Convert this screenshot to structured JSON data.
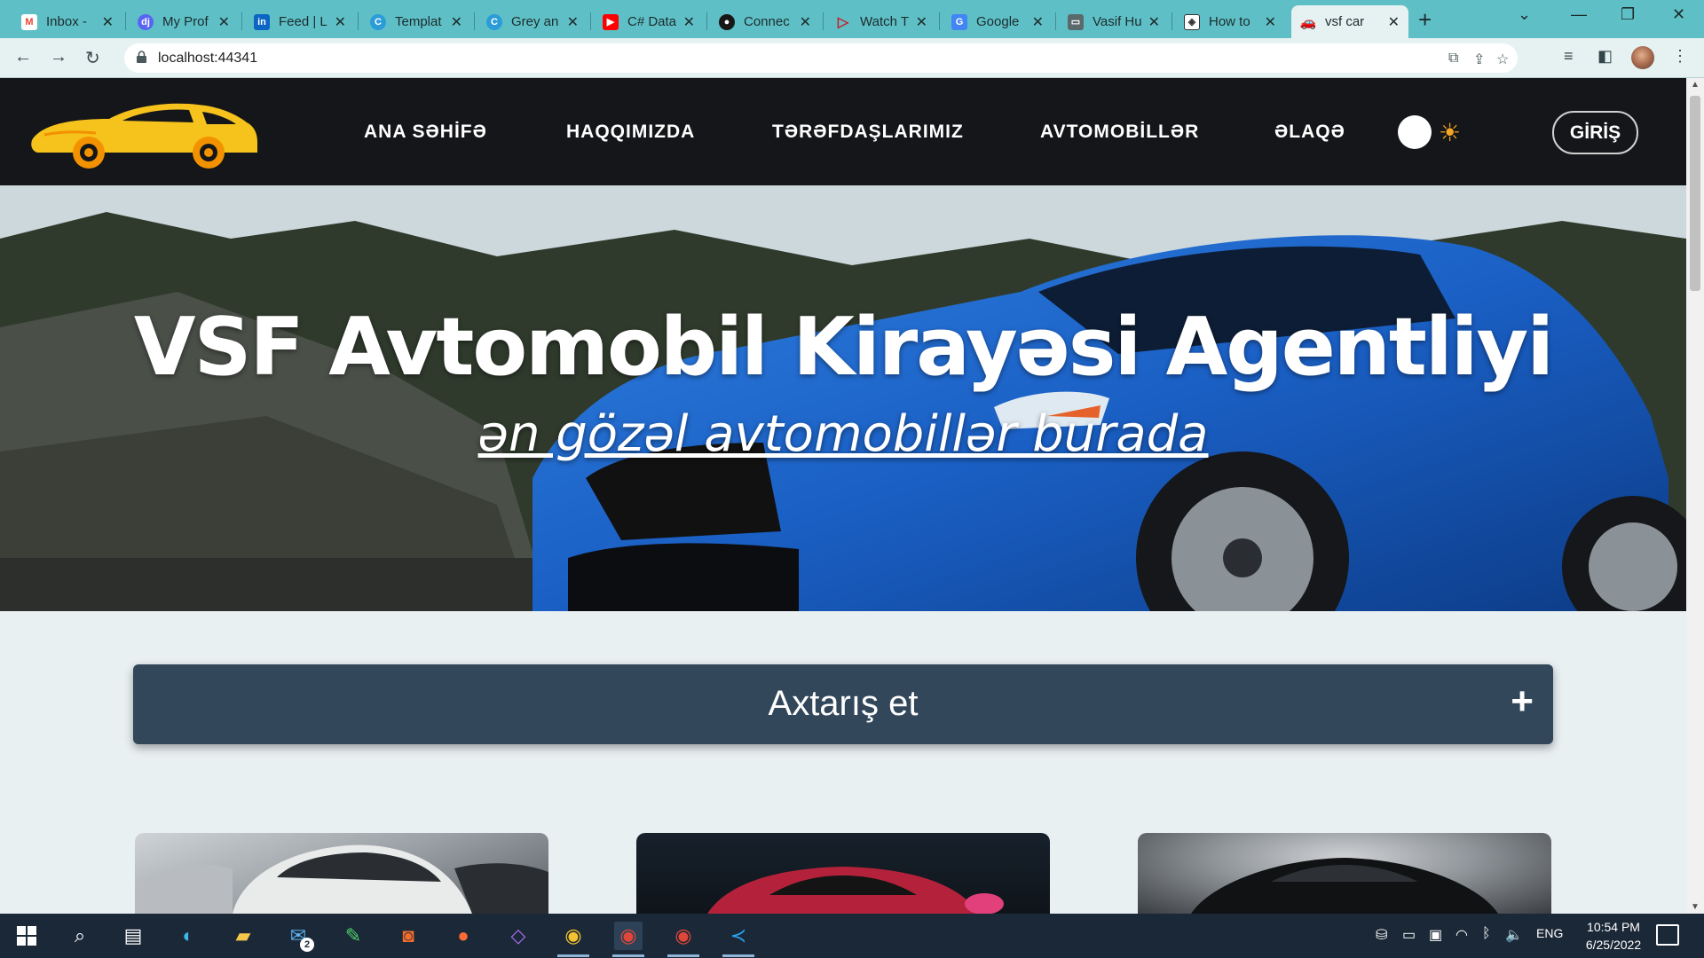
{
  "browser": {
    "tabs": [
      {
        "title": "Inbox -",
        "icon": "gmail-icon",
        "color": "#ea4335"
      },
      {
        "title": "My Prof",
        "icon": "dj-icon",
        "color": "#5865f2"
      },
      {
        "title": "Feed | L",
        "icon": "linkedin-icon",
        "color": "#0a66c2"
      },
      {
        "title": "Templat",
        "icon": "canva-icon",
        "color": "#2b9cd8"
      },
      {
        "title": "Grey an",
        "icon": "canva-icon",
        "color": "#2b9cd8"
      },
      {
        "title": "C# Data",
        "icon": "youtube-icon",
        "color": "#ff0000"
      },
      {
        "title": "Connec",
        "icon": "github-icon",
        "color": "#181717"
      },
      {
        "title": "Watch T",
        "icon": "play-icon",
        "color": "#c3222f"
      },
      {
        "title": "Google",
        "icon": "google-translate-icon",
        "color": "#4285f4"
      },
      {
        "title": "Vasif Hu",
        "icon": "monitor-icon",
        "color": "#5a6a6c"
      },
      {
        "title": "How to",
        "icon": "cube-icon",
        "color": "#333333"
      },
      {
        "title": "vsf car",
        "icon": "car-icon",
        "color": "#e0373c",
        "active": true
      }
    ],
    "url": "localhost:44341"
  },
  "site": {
    "nav": [
      "ANA SƏHİFƏ",
      "HAQQIMIZDA",
      "TƏRƏFDAŞLARIMIZ",
      "AVTOMOBİLLƏR",
      "ƏLAQƏ"
    ],
    "login": "GİRİŞ",
    "hero_title": "VSF Avtomobil Kirayəsi Agentliyi",
    "hero_subtitle": "ən gözəl avtomobillər burada",
    "search_title": "Axtarış et",
    "search_toggle": "+"
  },
  "taskbar": {
    "mail_badge": "2",
    "language": "ENG",
    "time": "10:54 PM",
    "date": "6/25/2022"
  },
  "colors": {
    "tabbar": "#5ec0c6",
    "nav_bg": "#151619",
    "search_bar": "#33475b",
    "logo_yellow": "#f6c21c",
    "logo_orange": "#f39200"
  }
}
